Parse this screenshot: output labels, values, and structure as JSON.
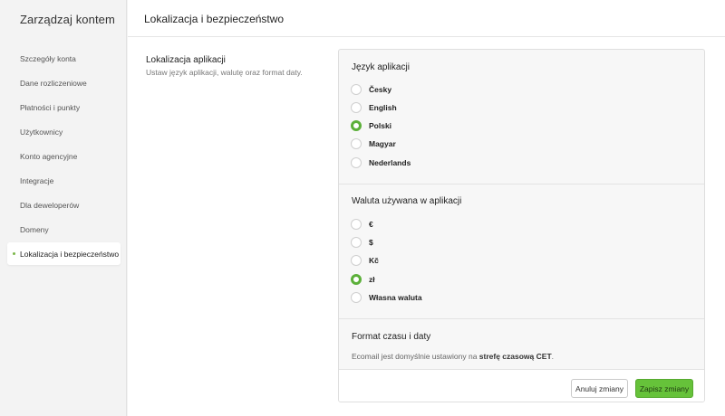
{
  "sidebar": {
    "title": "Zarządzaj kontem",
    "items": [
      {
        "label": "Szczegóły konta",
        "active": false
      },
      {
        "label": "Dane rozliczeniowe",
        "active": false
      },
      {
        "label": "Płatności i punkty",
        "active": false
      },
      {
        "label": "Użytkownicy",
        "active": false
      },
      {
        "label": "Konto agencyjne",
        "active": false
      },
      {
        "label": "Integracje",
        "active": false
      },
      {
        "label": "Dla deweloperów",
        "active": false
      },
      {
        "label": "Domeny",
        "active": false
      },
      {
        "label": "Lokalizacja i bezpieczeństwo",
        "active": true
      }
    ],
    "active_indicator_color": "#7ab648"
  },
  "header": {
    "title": "Lokalizacja i bezpieczeństwo"
  },
  "section": {
    "title": "Lokalizacja aplikacji",
    "description": "Ustaw język aplikacji, walutę oraz format daty."
  },
  "language": {
    "title": "Język aplikacji",
    "options": [
      {
        "label": "Česky",
        "checked": false
      },
      {
        "label": "English",
        "checked": false
      },
      {
        "label": "Polski",
        "checked": true
      },
      {
        "label": "Magyar",
        "checked": false
      },
      {
        "label": "Nederlands",
        "checked": false
      }
    ]
  },
  "currency": {
    "title": "Waluta używana w aplikacji",
    "options": [
      {
        "label": "€",
        "checked": false
      },
      {
        "label": "$",
        "checked": false
      },
      {
        "label": "Kč",
        "checked": false
      },
      {
        "label": "zł",
        "checked": true
      },
      {
        "label": "Własna waluta",
        "checked": false
      }
    ]
  },
  "format": {
    "title": "Format czasu i daty",
    "text_before": "Ecomail jest domyślnie ustawiony na ",
    "text_bold": "strefę czasową CET",
    "text_after": "."
  },
  "footer": {
    "cancel_label": "Anuluj zmiany",
    "save_label": "Zapisz zmiany"
  },
  "colors": {
    "accent": "#66c23a",
    "radio_checked": "#5cb03a"
  }
}
